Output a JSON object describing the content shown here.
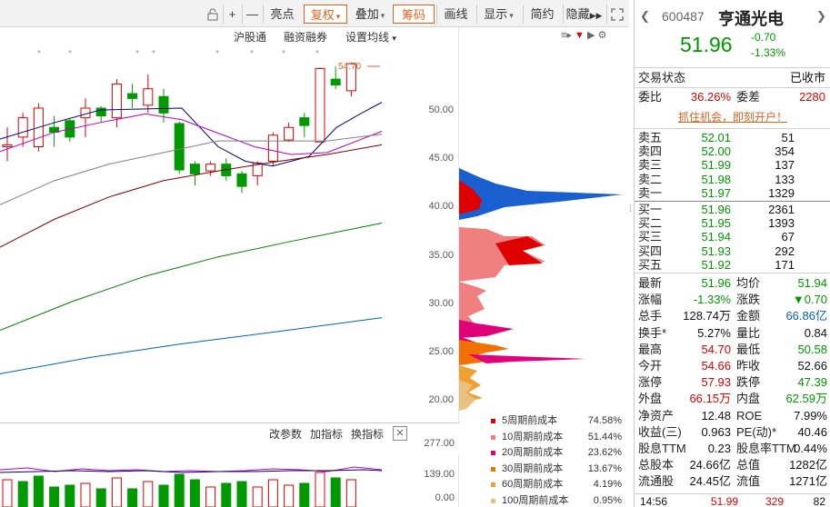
{
  "toolbar": {
    "zoom_in": "+",
    "zoom_out": "—",
    "highlight": "亮点",
    "adjust": "复权",
    "overlay": "叠加",
    "chips": "筹码",
    "draw": "画线",
    "display": "显示",
    "brief": "简约",
    "hide": "隐藏"
  },
  "kline": {
    "hk_connect": "沪股通",
    "margin": "融资融券",
    "set_ma": "设置均线",
    "high_marker": "54.70",
    "y_ticks": [
      "50.00",
      "45.00",
      "40.00",
      "35.00",
      "30.00",
      "25.00",
      "20.00"
    ],
    "vol_ticks": [
      "277.00",
      "139.00",
      "0.00"
    ],
    "params": "改参数",
    "add_indicator": "加指标",
    "switch_indicator": "换指标",
    "close": "✕"
  },
  "cost_legend": [
    {
      "label": "5周期前成本",
      "pct": "74.58%",
      "color": "#e00000"
    },
    {
      "label": "10周期前成本",
      "pct": "51.44%",
      "color": "#f08080"
    },
    {
      "label": "20周期前成本",
      "pct": "23.62%",
      "color": "#e0007a"
    },
    {
      "label": "30周期前成本",
      "pct": "13.67%",
      "color": "#f07000"
    },
    {
      "label": "60周期前成本",
      "pct": "4.19%",
      "color": "#f0a030"
    },
    {
      "label": "100周期前成本",
      "pct": "0.95%",
      "color": "#e8c080"
    }
  ],
  "stock": {
    "code": "600487",
    "name": "亨通光电",
    "price": "51.96",
    "change": "-0.70",
    "change_pct": "-1.33%",
    "status_label": "交易状态",
    "status": "已收市",
    "weibi_label": "委比",
    "weibi": "36.26%",
    "weicha_label": "委差",
    "weicha": "2280",
    "promo": "抓住机会，即刻开户！"
  },
  "sells": [
    {
      "label": "卖五",
      "price": "52.01",
      "vol": "51"
    },
    {
      "label": "卖四",
      "price": "52.00",
      "vol": "354"
    },
    {
      "label": "卖三",
      "price": "51.99",
      "vol": "137"
    },
    {
      "label": "卖二",
      "price": "51.98",
      "vol": "133"
    },
    {
      "label": "卖一",
      "price": "51.97",
      "vol": "1329"
    }
  ],
  "buys": [
    {
      "label": "买一",
      "price": "51.96",
      "vol": "2361"
    },
    {
      "label": "买二",
      "price": "51.95",
      "vol": "1393"
    },
    {
      "label": "买三",
      "price": "51.94",
      "vol": "67"
    },
    {
      "label": "买四",
      "price": "51.93",
      "vol": "292"
    },
    {
      "label": "买五",
      "price": "51.92",
      "vol": "171"
    }
  ],
  "stats": [
    {
      "l1": "最新",
      "v1": "51.96",
      "c1": "green",
      "l2": "均价",
      "v2": "51.94",
      "c2": "green"
    },
    {
      "l1": "涨幅",
      "v1": "-1.33%",
      "c1": "green",
      "l2": "涨跌",
      "v2": "▼0.70",
      "c2": "green"
    },
    {
      "l1": "总手",
      "v1": "128.74万",
      "c1": "dk",
      "l2": "金额",
      "v2": "66.86亿",
      "c2": "blue"
    },
    {
      "l1": "换手*",
      "v1": "5.27%",
      "c1": "dk",
      "l2": "量比",
      "v2": "0.84",
      "c2": "dk"
    },
    {
      "l1": "最高",
      "v1": "54.70",
      "c1": "red",
      "l2": "最低",
      "v2": "50.58",
      "c2": "green"
    },
    {
      "l1": "今开",
      "v1": "54.66",
      "c1": "red",
      "l2": "昨收",
      "v2": "52.66",
      "c2": "dk"
    },
    {
      "l1": "涨停",
      "v1": "57.93",
      "c1": "red",
      "l2": "跌停",
      "v2": "47.39",
      "c2": "green"
    },
    {
      "l1": "外盘",
      "v1": "66.15万",
      "c1": "red",
      "l2": "内盘",
      "v2": "62.59万",
      "c2": "green"
    },
    {
      "l1": "净资产",
      "v1": "12.48",
      "c1": "dk",
      "l2": "ROE",
      "v2": "7.99%",
      "c2": "dk"
    },
    {
      "l1": "收益(三)",
      "v1": "0.963",
      "c1": "dk",
      "l2": "PE(动)*",
      "v2": "40.46",
      "c2": "dk"
    },
    {
      "l1": "股息TTM",
      "v1": "0.23",
      "c1": "dk",
      "l2": "股息率TTM",
      "v2": "0.44%",
      "c2": "dk"
    },
    {
      "l1": "总股本",
      "v1": "24.66亿",
      "c1": "dk",
      "l2": "总值",
      "v2": "1282亿",
      "c2": "dk"
    },
    {
      "l1": "流通股",
      "v1": "24.45亿",
      "c1": "dk",
      "l2": "流值",
      "v2": "1271亿",
      "c2": "dk"
    }
  ],
  "tick": {
    "time": "14:56",
    "price": "51.99",
    "vol": "329",
    "n": "82"
  },
  "colors": {
    "up": "#e00000",
    "down": "#009900",
    "accent": "#e0621f",
    "ma5": "#000080",
    "ma10": "#c000c0",
    "ma20": "#808080",
    "ma30": "#800000",
    "ma60": "#008000",
    "ma120": "#0060c0"
  }
}
